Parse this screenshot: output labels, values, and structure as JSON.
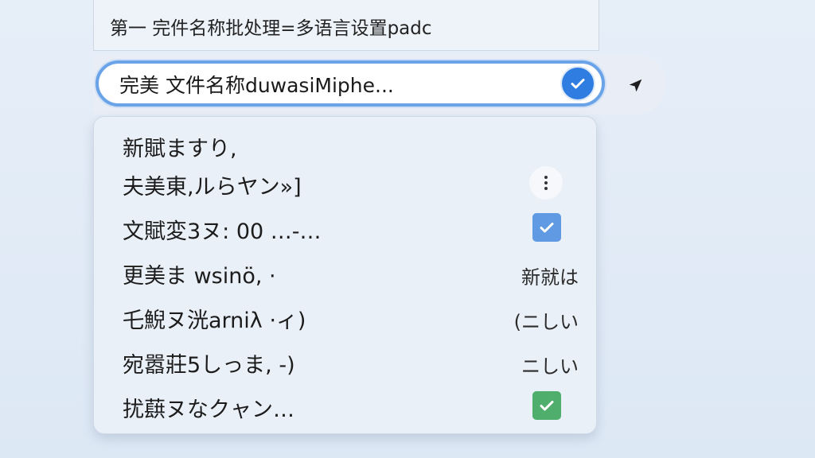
{
  "header": {
    "title": "第一 完件名称批处理=多语言设置padc"
  },
  "search": {
    "value": "完美 文件名称duwasiMiphe..."
  },
  "icons": {
    "confirm": "check-circle-icon",
    "locate": "navigation-arrow-icon",
    "more": "more-vertical-icon"
  },
  "colors": {
    "accent": "#2f7de1",
    "focus_ring": "#6aa3e8",
    "check_blue": "#5f9ae2",
    "check_green": "#4fae6b"
  },
  "dropdown": {
    "items": [
      {
        "label": "新賦ますり,",
        "trailing": ""
      },
      {
        "label": "夫美東,ルらヤン»]",
        "trailing": "more"
      },
      {
        "label": "文賦変3ヌ: 00 …-…",
        "trailing": "checked"
      },
      {
        "label": "更美ま wsinö, ·",
        "trailing": "新就は"
      },
      {
        "label": "乇鯢ヌ洸arniλ ⋅ィ)",
        "trailing": "(ニしい"
      },
      {
        "label": "宛嚣莊5しっま, -)",
        "trailing": "ニしい"
      },
      {
        "label": "扰蕻ヌなクャン…",
        "trailing": "checked"
      }
    ]
  }
}
